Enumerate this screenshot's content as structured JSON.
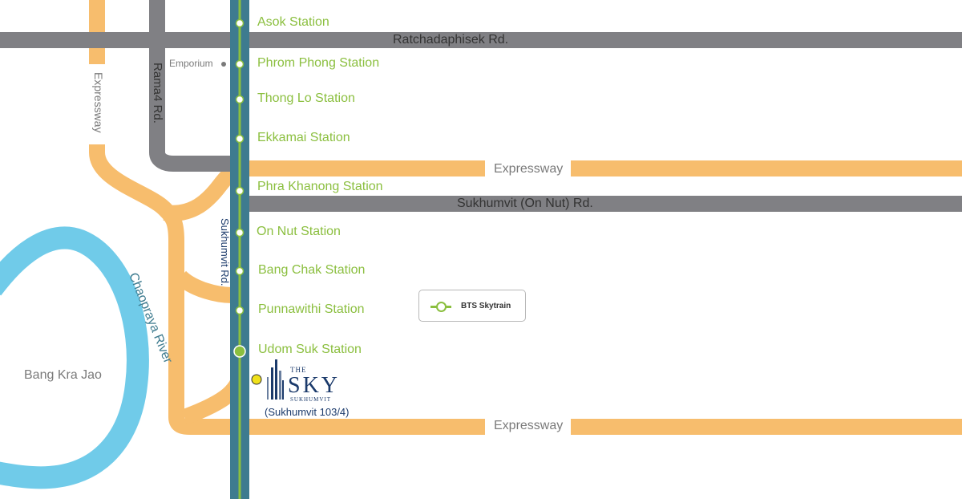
{
  "stations": [
    {
      "name": "Asok Station"
    },
    {
      "name": "Phrom Phong Station"
    },
    {
      "name": "Thong Lo Station"
    },
    {
      "name": "Ekkamai Station"
    },
    {
      "name": "Phra Khanong Station"
    },
    {
      "name": "On Nut Station"
    },
    {
      "name": "Bang Chak Station"
    },
    {
      "name": "Punnawithi Station"
    },
    {
      "name": "Udom Suk Station"
    }
  ],
  "roads": {
    "ratchadaphisek": "Ratchadaphisek Rd.",
    "sukhumvit_on_nut": "Sukhumvit (On Nut) Rd.",
    "expressway_top": "Expressway",
    "expressway_bottom": "Expressway",
    "expressway_vertical": "Expressway",
    "rama4": "Rama4 Rd.",
    "sukhumvit": "Sukhumvit Rd."
  },
  "places": {
    "emporium": "Emporium",
    "bang_kra_jao": "Bang Kra Jao",
    "river": "Chaopraya River"
  },
  "legend": {
    "label": "BTS Skytrain"
  },
  "project": {
    "logo_the": "THE",
    "logo_sky": "SKY",
    "logo_sub": "SUKHUMVIT",
    "address": "(Sukhumvit 103/4)"
  },
  "colors": {
    "orange_road": "#f7bd6d",
    "grey_road": "#808084",
    "bts_track": "#3e7b8f",
    "bts_line": "#8bbf3f",
    "river": "#70cbe9",
    "marker": "#f0e11a",
    "logo": "#1b3a6b"
  }
}
